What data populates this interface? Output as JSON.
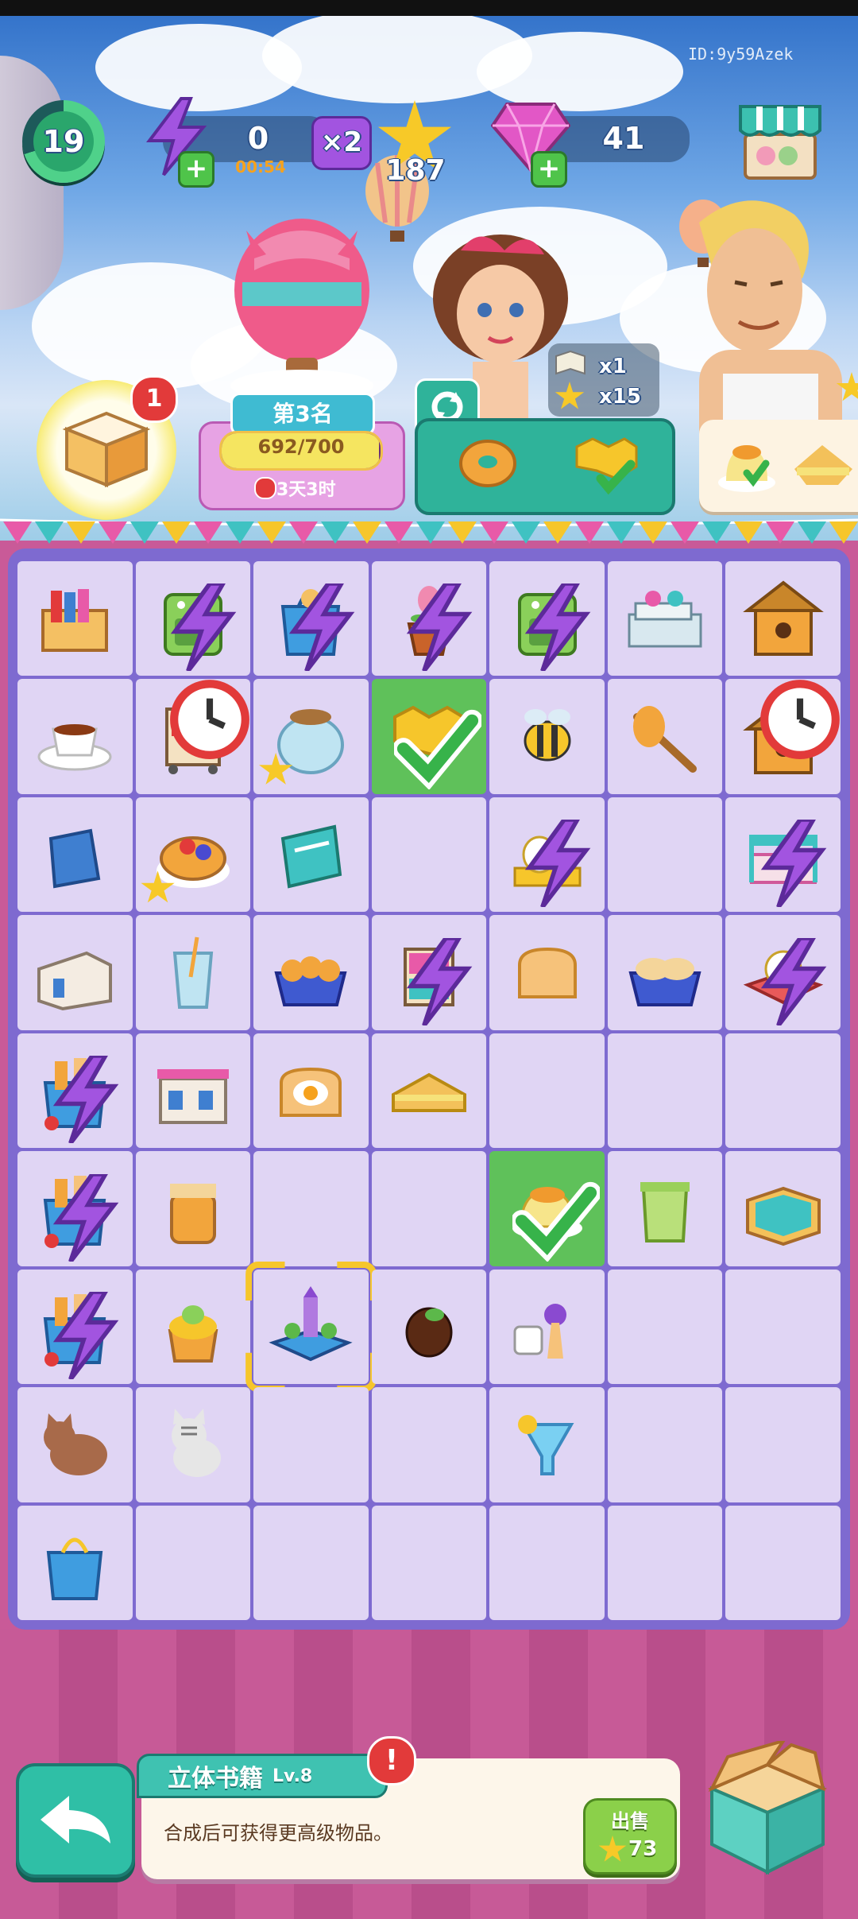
{
  "hud": {
    "level": "19",
    "energy": "0",
    "energy_timer": "00:54",
    "multiplier": "×2",
    "stars": "187",
    "gems": "41",
    "player_id": "ID:9y59Azek"
  },
  "event": {
    "rank": "第3名",
    "progress_text": "692/700",
    "progress_fraction": 0.9886,
    "time_left": "3天3时"
  },
  "storage": {
    "badge": "1"
  },
  "order": {
    "reward_item_count": "x1",
    "reward_star_count": "x15",
    "items": [
      "donut-icon",
      "honeycomb-icon"
    ]
  },
  "board": {
    "rows": [
      [
        "books-box",
        "oven-green",
        "shopping-bag-blue",
        "flower-pot",
        "oven-green",
        "glasses-books",
        "bee-house"
      ],
      [
        "tea-cup",
        "book-cart",
        "glass-teapot",
        "honeycomb",
        "bee",
        "honey-dipper",
        "bee-house"
      ],
      [
        "blue-box",
        "fruit-pie",
        "blue-book",
        "",
        "tea-set",
        "",
        "doll-bed"
      ],
      [
        "white-building",
        "glass-juice",
        "bread-rolls",
        "bookshelf-small",
        "toast",
        "bread-loaves",
        "teapot-tray"
      ],
      [
        "grocery-bag",
        "shop-building",
        "egg-toast",
        "sandwich",
        "",
        "",
        ""
      ],
      [
        "grocery-bag",
        "jam-jar",
        "",
        "",
        "pudding",
        "green-bin",
        "box-tray"
      ],
      [
        "grocery-bag",
        "cupcake",
        "popup-book",
        "chocolate",
        "board-game",
        "",
        ""
      ],
      [
        "brown-cat",
        "striped-cat",
        "",
        "",
        "cocktail",
        "",
        ""
      ],
      [
        "blue-bag",
        "",
        "",
        "",
        "",
        "",
        ""
      ]
    ],
    "green_cells": [
      "1-3",
      "5-4"
    ],
    "bolt_cells": [
      "0-1",
      "0-2",
      "0-3",
      "0-4",
      "2-4",
      "2-6",
      "3-3",
      "3-6",
      "4-0",
      "5-0",
      "6-0"
    ],
    "star_cells": [
      "1-2",
      "2-1"
    ],
    "timer_cells": [
      "1-1",
      "1-6"
    ],
    "selected_cell": "6-2"
  },
  "selected_item": {
    "name": "立体书籍",
    "level": "Lv.8",
    "description": "合成后可获得更高级物品。",
    "sell_label": "出售",
    "sell_price": "73"
  },
  "colors": {
    "board": "#7e6ad0",
    "cell": "#e0d5f4",
    "green": "#5fc15a",
    "teal": "#2fb39a",
    "pink": "#c95a98"
  }
}
